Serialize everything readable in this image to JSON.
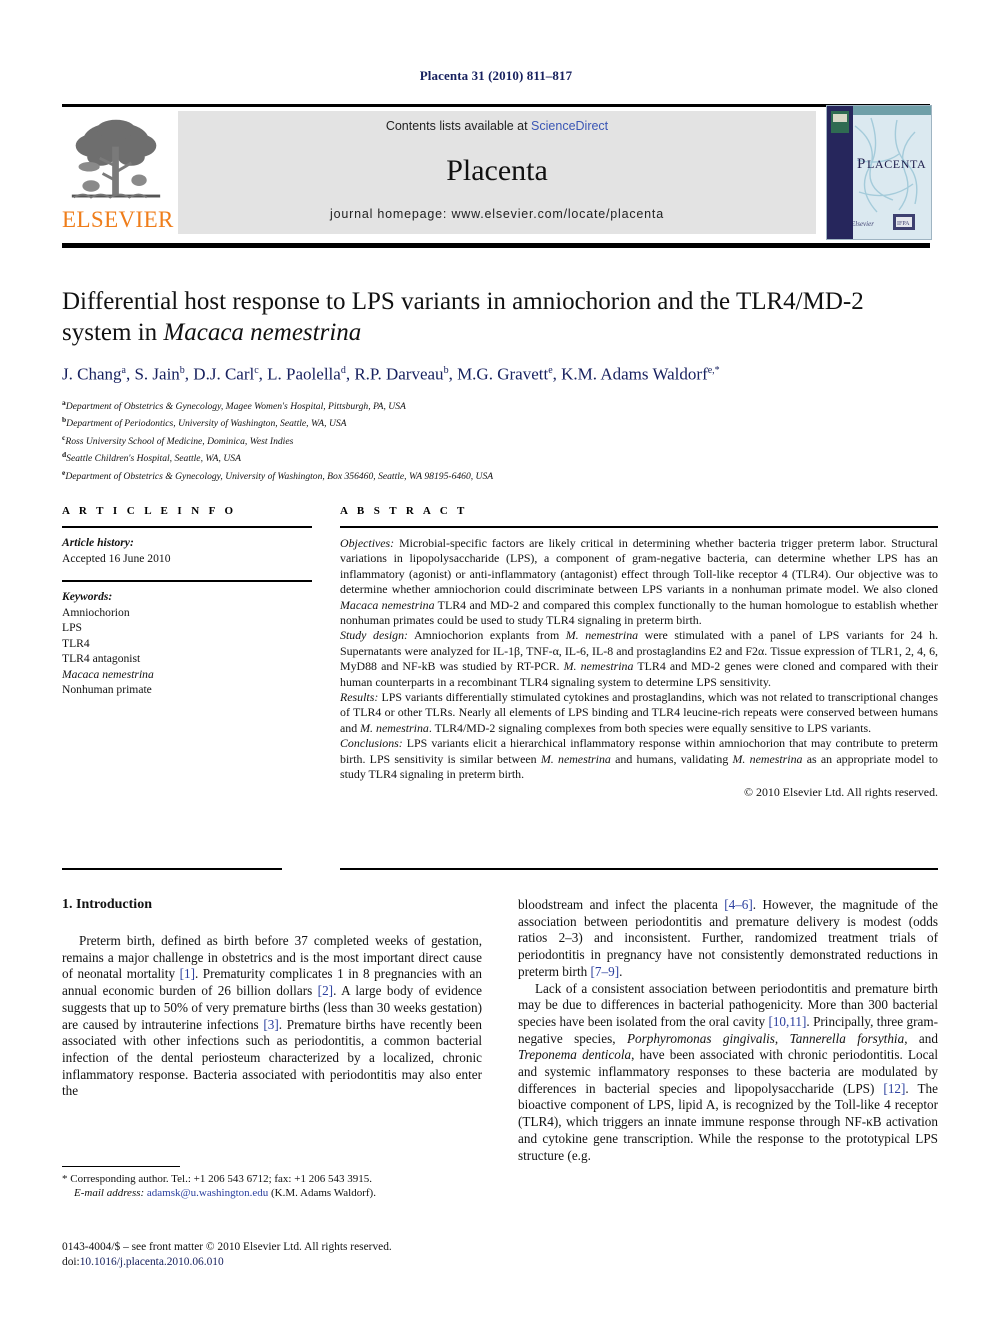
{
  "running_head": "Placenta 31 (2010) 811–817",
  "masthead": {
    "contents_text": "Contents lists available at ",
    "sciencedirect": "ScienceDirect",
    "journal_name": "Placenta",
    "homepage": "journal homepage: www.elsevier.com/locate/placenta",
    "publisher_logo_text": "ELSEVIER",
    "cover_title": "PLACENTA",
    "link_color": "#3a56b5",
    "publisher_color": "#ef7d1a"
  },
  "article": {
    "title_part1": "Differential host response to LPS variants in amniochorion and the TLR4/MD-2 system in ",
    "title_italic": "Macaca nemestrina",
    "authors": "J. Chang a, S. Jain b, D.J. Carl c, L. Paolella d, R.P. Darveau b, M.G. Gravett e, K.M. Adams Waldorf e,*",
    "affiliations": [
      {
        "mark": "a",
        "text": "Department of Obstetrics & Gynecology, Magee Women's Hospital, Pittsburgh, PA, USA"
      },
      {
        "mark": "b",
        "text": "Department of Periodontics, University of Washington, Seattle, WA, USA"
      },
      {
        "mark": "c",
        "text": "Ross University School of Medicine, Dominica, West Indies"
      },
      {
        "mark": "d",
        "text": "Seattle Children's Hospital, Seattle, WA, USA"
      },
      {
        "mark": "e",
        "text": "Department of Obstetrics & Gynecology, University of Washington, Box 356460, Seattle, WA 98195-6460, USA"
      }
    ]
  },
  "article_info": {
    "heading": "A R T I C L E  I N F O",
    "history_label": "Article history:",
    "history_value": "Accepted 16 June 2010",
    "keywords_label": "Keywords:",
    "keywords": [
      "Amniochorion",
      "LPS",
      "TLR4",
      "TLR4 antagonist",
      "Macaca nemestrina",
      "Nonhuman primate"
    ],
    "keyword_italic_index": 4
  },
  "abstract": {
    "heading": "A B S T R A C T",
    "sections": [
      {
        "label": "Objectives:",
        "text": " Microbial-specific factors are likely critical in determining whether bacteria trigger preterm labor. Structural variations in lipopolysaccharide (LPS), a component of gram-negative bacteria, can determine whether LPS has an inflammatory (agonist) or anti-inflammatory (antagonist) effect through Toll-like receptor 4 (TLR4). Our objective was to determine whether amniochorion could discriminate between LPS variants in a nonhuman primate model. We also cloned Macaca nemestrina TLR4 and MD-2 and compared this complex functionally to the human homologue to establish whether nonhuman primates could be used to study TLR4 signaling in preterm birth."
      },
      {
        "label": "Study design:",
        "text": " Amniochorion explants from M. nemestrina were stimulated with a panel of LPS variants for 24 h. Supernatants were analyzed for IL-1β, TNF-α, IL-6, IL-8 and prostaglandins E2 and F2α. Tissue expression of TLR1, 2, 4, 6, MyD88 and NF-kB was studied by RT-PCR. M. nemestrina TLR4 and MD-2 genes were cloned and compared with their human counterparts in a recombinant TLR4 signaling system to determine LPS sensitivity."
      },
      {
        "label": "Results:",
        "text": " LPS variants differentially stimulated cytokines and prostaglandins, which was not related to transcriptional changes of TLR4 or other TLRs. Nearly all elements of LPS binding and TLR4 leucine-rich repeats were conserved between humans and M. nemestrina. TLR4/MD-2 signaling complexes from both species were equally sensitive to LPS variants."
      },
      {
        "label": "Conclusions:",
        "text": " LPS variants elicit a hierarchical inflammatory response within amniochorion that may contribute to preterm birth. LPS sensitivity is similar between M. nemestrina and humans, validating M. nemestrina as an appropriate model to study TLR4 signaling in preterm birth."
      }
    ],
    "copyright": "© 2010 Elsevier Ltd. All rights reserved."
  },
  "introduction": {
    "heading": "1.  Introduction",
    "left_paragraphs": [
      "Preterm birth, defined as birth before 37 completed weeks of gestation, remains a major challenge in obstetrics and is the most important direct cause of neonatal mortality [1]. Prematurity complicates 1 in 8 pregnancies with an annual economic burden of 26 billion dollars [2]. A large body of evidence suggests that up to 50% of very premature births (less than 30 weeks gestation) are caused by intrauterine infections [3]. Premature births have recently been associated with other infections such as periodontitis, a common bacterial infection of the dental periosteum characterized by a localized, chronic inflammatory response. Bacteria associated with periodontitis may also enter the"
    ],
    "right_paragraphs": [
      "bloodstream and infect the placenta [4–6]. However, the magnitude of the association between periodontitis and premature delivery is modest (odds ratios 2–3) and inconsistent. Further, randomized treatment trials of periodontitis in pregnancy have not consistently demonstrated reductions in preterm birth [7–9].",
      "Lack of a consistent association between periodontitis and premature birth may be due to differences in bacterial pathogenicity. More than 300 bacterial species have been isolated from the oral cavity [10,11]. Principally, three gram-negative species, Porphyromonas gingivalis, Tannerella forsythia, and Treponema denticola, have been associated with chronic periodontitis. Local and systemic inflammatory responses to these bacteria are modulated by differences in bacterial species and lipopolysaccharide (LPS) [12]. The bioactive component of LPS, lipid A, is recognized by the Toll-like 4 receptor (TLR4), which triggers an innate immune response through NF-κB activation and cytokine gene transcription. While the response to the prototypical LPS structure (e.g."
    ]
  },
  "footnote": {
    "corresponding": "* Corresponding author. Tel.: +1 206 543 6712; fax: +1 206 543 3915.",
    "email_label": "E-mail address:",
    "email": "adamsk@u.washington.edu",
    "email_suffix": " (K.M. Adams Waldorf)."
  },
  "imprint": {
    "line1": "0143-4004/$ – see front matter © 2010 Elsevier Ltd. All rights reserved.",
    "doi_label": "doi:",
    "doi": "10.1016/j.placenta.2010.06.010"
  }
}
